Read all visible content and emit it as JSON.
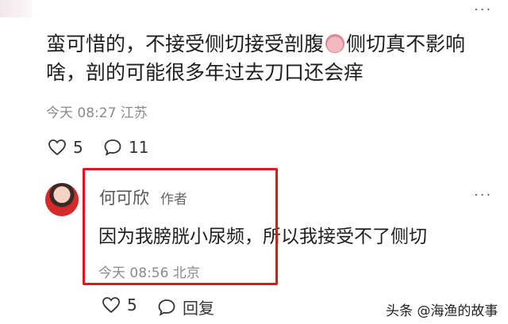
{
  "comment": {
    "text_line1_a": "蛮可惜的，不接受侧切接受剖腹",
    "text_line1_b": "侧切真不影响",
    "text_line2": "啥，剖的可能很多年过去刀口还会痒",
    "meta": "今天 08:27 江苏",
    "likes": "5",
    "replies": "11"
  },
  "reply": {
    "author": "何可欣",
    "author_tag": "作者",
    "text": "因为我膀胱小尿频，所以我接受不了侧切",
    "meta": "今天 08:56 北京",
    "likes": "5",
    "reply_label": "回复"
  },
  "watermark": "头条 @海渔的故事",
  "icons": [
    "more-icon",
    "heart-icon",
    "comment-bubble-icon",
    "avatar",
    "emoji-icon"
  ],
  "colors": {
    "highlight_border": "#e0161b",
    "meta_text": "#8a8a8a"
  }
}
